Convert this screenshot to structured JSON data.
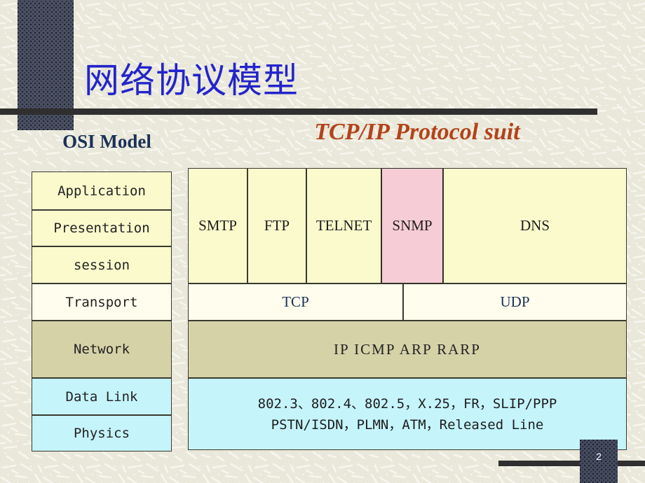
{
  "slide": {
    "title": "网络协议模型",
    "page_number": "2",
    "colors": {
      "title_blue": "#2424cc",
      "heading_navy": "#1b3157",
      "heading_rust": "#b3431a",
      "bar_dark": "#2f2f2f",
      "block_slate": "#454b5e",
      "background": "#e9e8da",
      "cell_yellow": "#fafacd",
      "cell_ivory": "#fffded",
      "cell_olive": "#d6d2a8",
      "cell_cyan": "#c5f4fb",
      "cell_pink": "#f6ccd6"
    }
  },
  "osi": {
    "heading": "OSI Model",
    "layers": [
      {
        "label": "Application",
        "color": "#fafacd"
      },
      {
        "label": "Presentation",
        "color": "#fafacd"
      },
      {
        "label": "session",
        "color": "#fafacd"
      },
      {
        "label": "Transport",
        "color": "#fffded"
      },
      {
        "label": "Network",
        "color": "#d6d2a8"
      },
      {
        "label": "Data Link",
        "color": "#c5f4fb"
      },
      {
        "label": "Physics",
        "color": "#c5f4fb"
      }
    ]
  },
  "tcpip": {
    "heading": "TCP/IP Protocol suit",
    "application_row": [
      {
        "label": "SMTP",
        "highlight": false
      },
      {
        "label": "FTP",
        "highlight": false
      },
      {
        "label": "TELNET",
        "highlight": false
      },
      {
        "label": "SNMP",
        "highlight": true
      },
      {
        "label": "DNS",
        "highlight": false
      }
    ],
    "transport_row": [
      {
        "label": "TCP"
      },
      {
        "label": "UDP"
      }
    ],
    "network_row": {
      "label": "IP   ICMP    ARP   RARP"
    },
    "link_row": {
      "line1": "802.3、802.4、802.5，X.25，FR，SLIP/PPP",
      "line2": "PSTN/ISDN，PLMN，ATM，Released Line"
    }
  }
}
